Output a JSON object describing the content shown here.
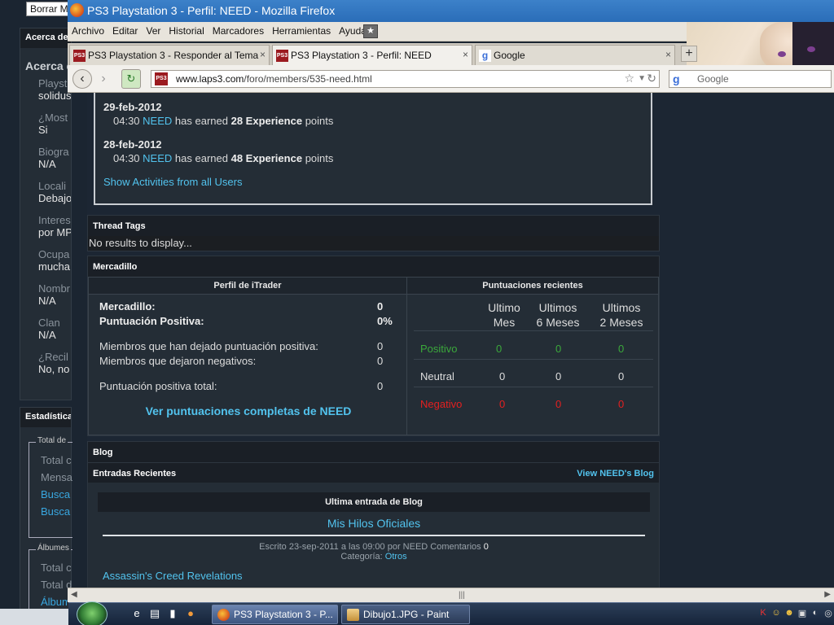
{
  "background_page": {
    "top_button": "Borrar M",
    "panel_head": "Acerca de",
    "subtitle": "Acerca d",
    "fields": [
      {
        "label": "Playst",
        "value": "solidus"
      },
      {
        "label": "¿Most",
        "value": "Si"
      },
      {
        "label": "Biogra",
        "value": "N/A"
      },
      {
        "label": "Locali",
        "value": "Debajo"
      },
      {
        "label": "Interes",
        "value": "por MP"
      },
      {
        "label": "Ocupa",
        "value": "mucha"
      },
      {
        "label": "Nombr",
        "value": "N/A"
      },
      {
        "label": "Clan",
        "value": "N/A"
      },
      {
        "label": "¿Recil",
        "value": "No, no"
      }
    ],
    "stats_head": "Estadística",
    "box1_title": "Total de",
    "box1_rows": [
      "Total c",
      "Mensa",
      "Busca",
      "Busca"
    ],
    "box2_title": "Álbumes",
    "box2_rows": [
      "Total c",
      "Total d",
      "Álbum"
    ]
  },
  "window": {
    "title": "PS3 Playstation 3 - Perfil: NEED - Mozilla Firefox",
    "menu": [
      "Archivo",
      "Editar",
      "Ver",
      "Historial",
      "Marcadores",
      "Herramientas",
      "Ayuda"
    ],
    "tabs": [
      {
        "label": "PS3 Playstation 3 - Responder al Tema",
        "icon": "PS3"
      },
      {
        "label": "PS3 Playstation 3 - Perfil: NEED",
        "icon": "PS3"
      },
      {
        "label": "Google",
        "icon": "g"
      }
    ],
    "newtab": "+",
    "url_host": "www.laps3.com",
    "url_path": "/foro/members/535-need.html",
    "search_placeholder": "Google"
  },
  "activity": [
    {
      "date": "29-feb-2012",
      "time": "04:30",
      "user": "NEED",
      "pre": "has earned",
      "amount": "28 Experience",
      "post": "points"
    },
    {
      "date": "28-feb-2012",
      "time": "04:30",
      "user": "NEED",
      "pre": "has earned",
      "amount": "48 Experience",
      "post": "points"
    }
  ],
  "activity_link": "Show Activities from all Users",
  "thread_tags": {
    "head": "Thread Tags",
    "empty": "No results to display..."
  },
  "mercadillo": {
    "head": "Mercadillo",
    "left_head": "Perfil de iTrader",
    "right_head": "Puntuaciones recientes",
    "rows": [
      {
        "label": "Mercadillo:",
        "value": "0"
      },
      {
        "label": "Puntuación Positiva:",
        "value": "0%"
      },
      {
        "label": "Miembros que han dejado puntuación positiva:",
        "value": "0"
      },
      {
        "label": "Miembros que dejaron negativos:",
        "value": "0"
      },
      {
        "label": "Puntuación positiva total:",
        "value": "0"
      }
    ],
    "link": "Ver puntuaciones completas de NEED",
    "col_heads": [
      [
        "Ultimo",
        "Mes"
      ],
      [
        "Ultimos",
        "6 Meses"
      ],
      [
        "Ultimos",
        "2 Meses"
      ]
    ],
    "ratings": [
      {
        "label": "Positivo",
        "values": [
          "0",
          "0",
          "0"
        ],
        "color": "#3ba83b"
      },
      {
        "label": "Neutral",
        "values": [
          "0",
          "0",
          "0"
        ],
        "color": "#dddddd"
      },
      {
        "label": "Negativo",
        "values": [
          "0",
          "0",
          "0"
        ],
        "color": "#e32020"
      }
    ]
  },
  "blog": {
    "head": "Blog",
    "sub_head": "Entradas Recientes",
    "view_link": "View NEED's Blog",
    "entry_head": "Ultima entrada de Blog",
    "entry_title": "Mis Hilos Oficiales",
    "meta_pre": "Escrito 23-sep-2011 a las 09:00 por NEED Comentarios",
    "meta_count": "0",
    "category_label": "Categoría:",
    "category": "Otros",
    "next_title": "Assassin's Creed Revelations"
  },
  "taskbar": {
    "buttons": [
      {
        "label": "PS3 Playstation 3 - P...",
        "icon": "firefox-icon"
      },
      {
        "label": "Dibujo1.JPG - Paint",
        "icon": "paint-icon"
      }
    ]
  }
}
